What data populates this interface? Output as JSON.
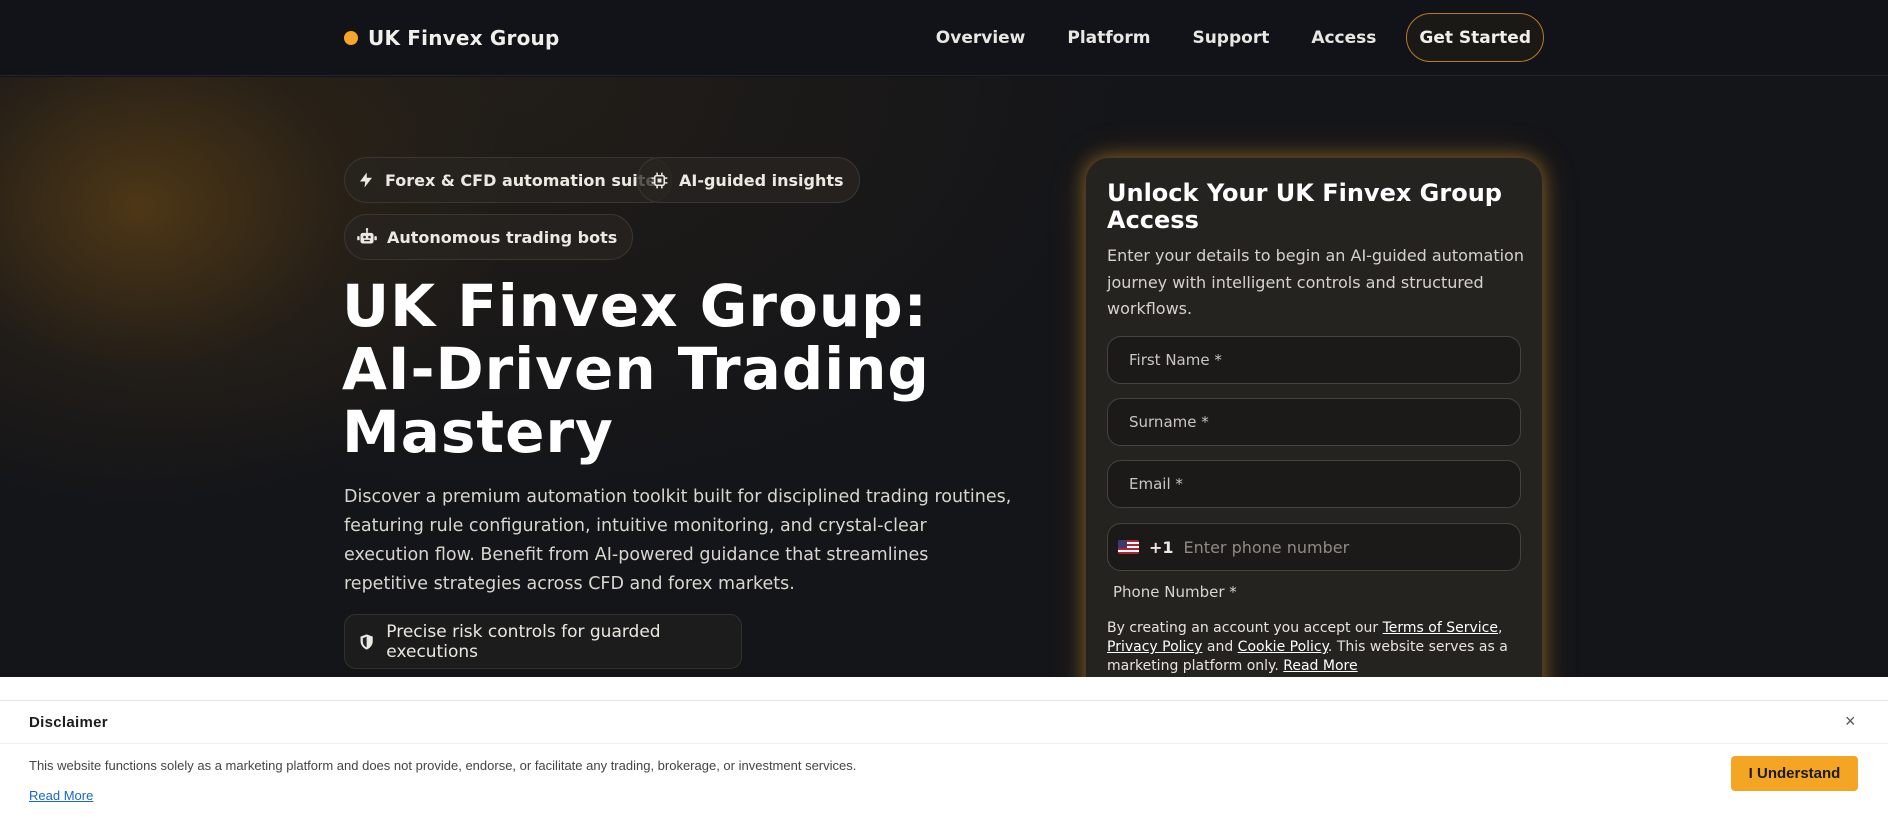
{
  "header": {
    "brand": "UK Finvex Group",
    "nav": [
      "Overview",
      "Platform",
      "Support",
      "Access"
    ],
    "cta": "Get Started"
  },
  "hero": {
    "chips": [
      {
        "label": "Forex & CFD automation suite",
        "icon": "lightning-icon"
      },
      {
        "label": "AI-guided insights",
        "icon": "chip-icon"
      },
      {
        "label": "Autonomous trading bots",
        "icon": "robot-icon"
      }
    ],
    "title": "UK Finvex Group: AI-Driven Trading Mastery",
    "description": "Discover a premium automation toolkit built for disciplined trading routines, featuring rule configuration, intuitive monitoring, and crystal-clear execution flow. Benefit from AI-powered guidance that streamlines repetitive strategies across CFD and forex markets.",
    "risk_note": "Precise risk controls for guarded executions"
  },
  "form": {
    "title": "Unlock Your UK Finvex Group Access",
    "subtitle": "Enter your details to begin an AI-guided automation journey with intelligent controls and structured workflows.",
    "first_name": "First Name *",
    "surname": "Surname *",
    "email": "Email *",
    "dial_code": "+1",
    "phone_placeholder": "Enter phone number",
    "phone_label": "Phone Number *",
    "terms_prefix": "By creating an account you accept our ",
    "terms_link": "Terms of Service",
    "privacy_link": "Privacy Policy",
    "and": " and ",
    "cookie_link": "Cookie Policy",
    "terms_suffix": ". This website serves as a marketing platform only. ",
    "read_more": "Read More"
  },
  "disclaimer": {
    "title": "Disclaimer",
    "text": "This website functions solely as a marketing platform and does not provide, endorse, or facilitate any trading, brokerage, or investment services.",
    "read_more": "Read More",
    "button": "I Understand",
    "close": "×"
  },
  "colors": {
    "accent": "#f4a52a",
    "background": "#111318"
  }
}
